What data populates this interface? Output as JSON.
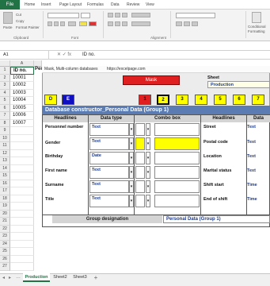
{
  "ribbon": {
    "file_tab": "File",
    "tabs": [
      "Home",
      "Insert",
      "Page Layout",
      "Formulas",
      "Data",
      "Review",
      "View"
    ],
    "clipboard": {
      "paste": "Paste",
      "cut": "Cut",
      "copy": "Copy",
      "format_painter": "Format Painter",
      "group_label": "Clipboard"
    },
    "font_group_label": "Font",
    "alignment_group_label": "Alignment",
    "right_labels": [
      "Conditional",
      "Formatting"
    ]
  },
  "formula_bar": {
    "name_box": "A1",
    "content": "ID no."
  },
  "grid": {
    "columns": [
      "A"
    ],
    "rows": [
      {
        "n": "1",
        "a": "ID no."
      },
      {
        "n": "2",
        "a": "10001"
      },
      {
        "n": "3",
        "a": "10002"
      },
      {
        "n": "4",
        "a": "10003"
      },
      {
        "n": "5",
        "a": "10004"
      },
      {
        "n": "6",
        "a": "10005"
      },
      {
        "n": "7",
        "a": "10006"
      },
      {
        "n": "8",
        "a": "10007"
      },
      {
        "n": "9",
        "a": ""
      },
      {
        "n": "10",
        "a": ""
      },
      {
        "n": "11",
        "a": ""
      },
      {
        "n": "12",
        "a": ""
      },
      {
        "n": "13",
        "a": ""
      },
      {
        "n": "14",
        "a": ""
      },
      {
        "n": "15",
        "a": ""
      },
      {
        "n": "16",
        "a": ""
      },
      {
        "n": "17",
        "a": ""
      },
      {
        "n": "18",
        "a": ""
      },
      {
        "n": "19",
        "a": ""
      },
      {
        "n": "20",
        "a": ""
      },
      {
        "n": "21",
        "a": ""
      },
      {
        "n": "22",
        "a": ""
      },
      {
        "n": "23",
        "a": ""
      },
      {
        "n": "24",
        "a": ""
      },
      {
        "n": "25",
        "a": ""
      },
      {
        "n": "26",
        "a": ""
      },
      {
        "n": "27",
        "a": ""
      }
    ],
    "col_b_partial": "Per"
  },
  "dialog": {
    "title": "Mask, Multi-column databases",
    "url": "https://excelpage.com",
    "mask_button": "Mask",
    "sheet_label": "Sheet",
    "sheet_value": "Production",
    "buttons_left": [
      "D",
      "E"
    ],
    "buttons_num": [
      "1",
      "2",
      "3",
      "4",
      "5",
      "6",
      "7"
    ],
    "db_title": "Database constructor_Personal Data (Group 1)",
    "headers": {
      "headlines": "Headlines",
      "data_type": "Data type",
      "combo_box": "Combo box",
      "headlines2": "Headlines",
      "data2": "Data"
    },
    "rows_left": [
      {
        "label": "Personnel number",
        "type": "Text"
      },
      {
        "label": "Gender",
        "type": "Text"
      },
      {
        "label": "Birthday",
        "type": "Date"
      },
      {
        "label": "First name",
        "type": "Text"
      },
      {
        "label": "Surname",
        "type": "Text"
      },
      {
        "label": "Title",
        "type": "Text"
      }
    ],
    "rows_right": [
      {
        "label": "Street",
        "type": "Text"
      },
      {
        "label": "Postal code",
        "type": "Text"
      },
      {
        "label": "Location",
        "type": "Text"
      },
      {
        "label": "Marital status",
        "type": "Text"
      },
      {
        "label": "Shift start",
        "type": "Time"
      },
      {
        "label": "End of shift",
        "type": "Time"
      }
    ],
    "group_designation_label": "Group designation",
    "group_designation_value": "Personal Data (Group 1)"
  },
  "sheets": {
    "tabs": [
      "Production",
      "Sheet2",
      "Sheet3"
    ],
    "add": "+"
  },
  "colors": {
    "excel_green": "#217346",
    "mask_red": "#e02020",
    "blue_bar": "#5b7bb3",
    "yellow": "#ffff00",
    "blue_btn": "#1010c0"
  }
}
